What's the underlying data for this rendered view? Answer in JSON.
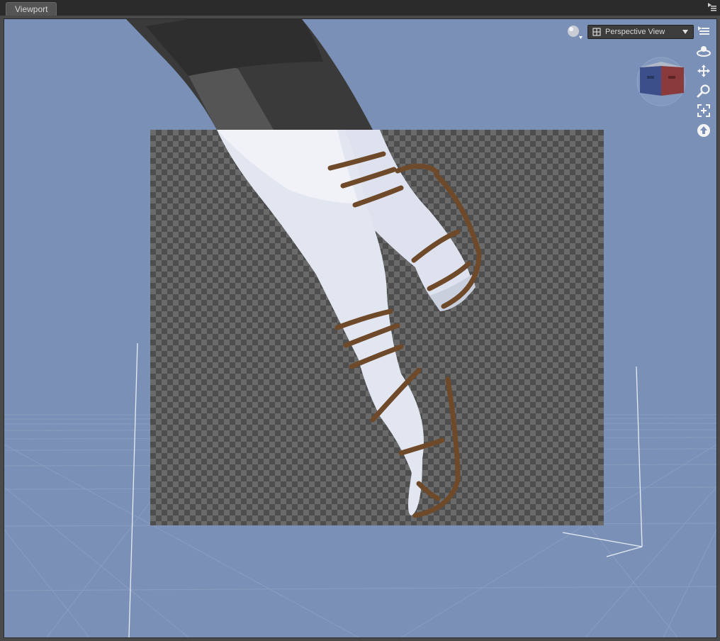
{
  "window": {
    "tab_label": "Viewport"
  },
  "viewport": {
    "view_selector_label": "Perspective View",
    "background_color": "#7a90b6",
    "checker_light": "#6a6a6a",
    "checker_dark": "#4e4e4e",
    "icons": {
      "draw_style": "sphere-icon",
      "view_menu": "list-icon",
      "orbit": "orbit-icon",
      "pan": "move-icon",
      "zoom": "zoom-icon",
      "frame": "frame-icon",
      "reset": "reset-icon",
      "navigation_cube": "navigation-cube-icon"
    }
  }
}
